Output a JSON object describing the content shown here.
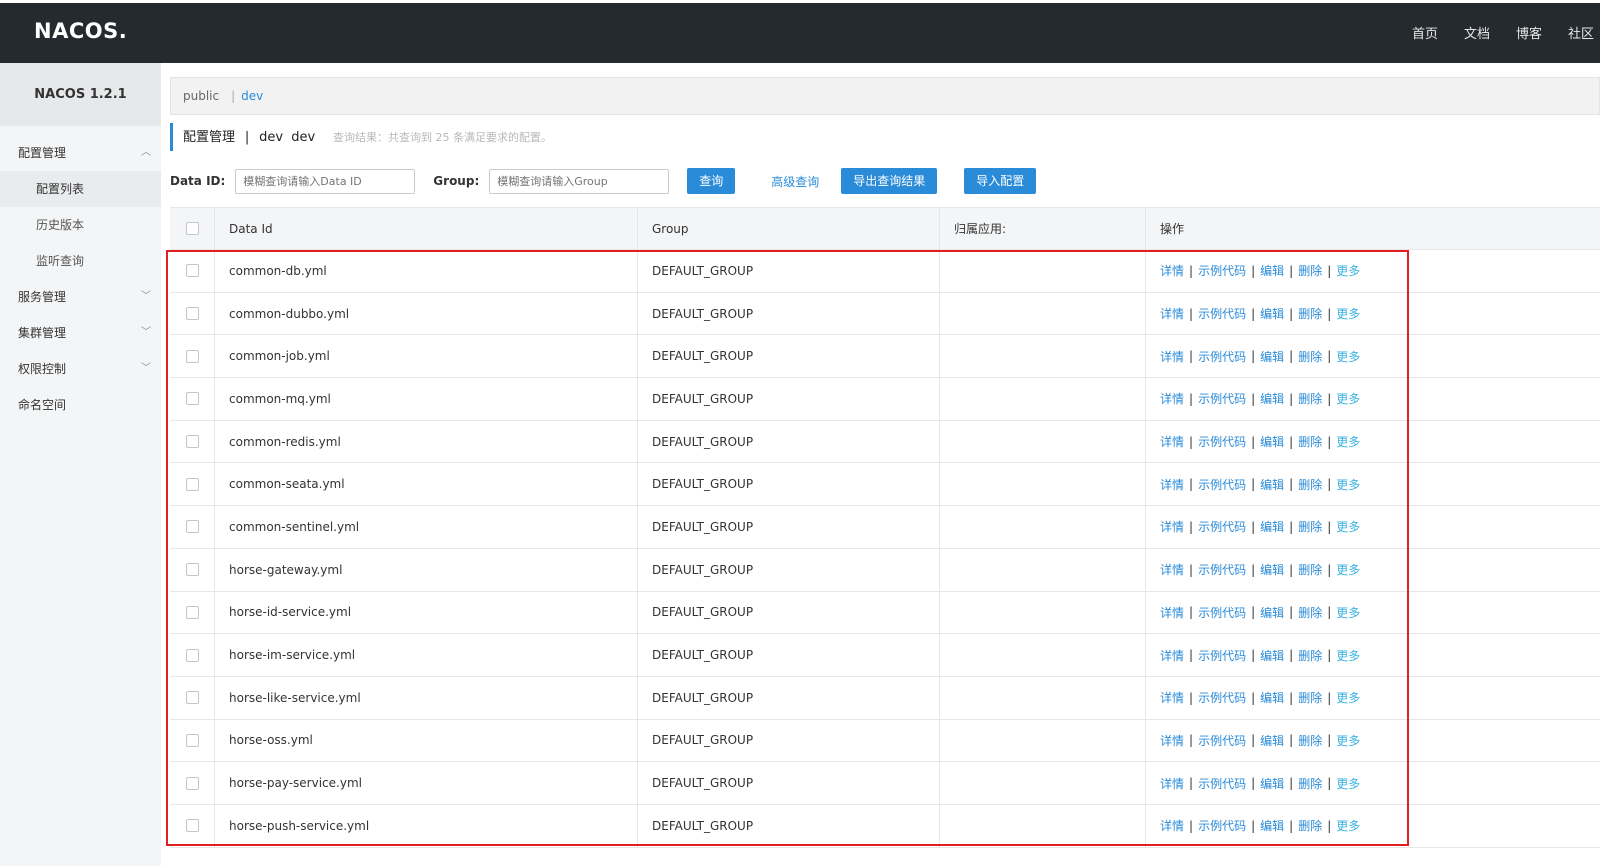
{
  "header": {
    "logo": "NACOS.",
    "nav": [
      "首页",
      "文档",
      "博客",
      "社区"
    ]
  },
  "sidebar": {
    "version": "NACOS 1.2.1",
    "menu": {
      "config": "配置管理",
      "config_list": "配置列表",
      "history": "历史版本",
      "listen": "监听查询",
      "service": "服务管理",
      "cluster": "集群管理",
      "auth": "权限控制",
      "namespace": "命名空间"
    }
  },
  "namespace_bar": {
    "public": "public",
    "separator": "|",
    "dev": "dev"
  },
  "title": {
    "main": "配置管理",
    "sep": "|",
    "ns": "dev  dev",
    "result": "查询结果：共查询到 25 条满足要求的配置。"
  },
  "filter": {
    "dataid_label": "Data ID:",
    "dataid_placeholder": "模糊查询请输入Data ID",
    "group_label": "Group:",
    "group_placeholder": "模糊查询请输入Group",
    "search_btn": "查询",
    "advanced": "高级查询",
    "export_btn": "导出查询结果",
    "import_btn": "导入配置"
  },
  "table": {
    "columns": [
      "Data Id",
      "Group",
      "归属应用:",
      "操作"
    ],
    "actions": [
      "详情",
      "示例代码",
      "编辑",
      "删除",
      "更多"
    ],
    "action_sep": "|",
    "rows": [
      {
        "data_id": "common-db.yml",
        "group": "DEFAULT_GROUP",
        "app": ""
      },
      {
        "data_id": "common-dubbo.yml",
        "group": "DEFAULT_GROUP",
        "app": ""
      },
      {
        "data_id": "common-job.yml",
        "group": "DEFAULT_GROUP",
        "app": ""
      },
      {
        "data_id": "common-mq.yml",
        "group": "DEFAULT_GROUP",
        "app": ""
      },
      {
        "data_id": "common-redis.yml",
        "group": "DEFAULT_GROUP",
        "app": ""
      },
      {
        "data_id": "common-seata.yml",
        "group": "DEFAULT_GROUP",
        "app": ""
      },
      {
        "data_id": "common-sentinel.yml",
        "group": "DEFAULT_GROUP",
        "app": ""
      },
      {
        "data_id": "horse-gateway.yml",
        "group": "DEFAULT_GROUP",
        "app": ""
      },
      {
        "data_id": "horse-id-service.yml",
        "group": "DEFAULT_GROUP",
        "app": ""
      },
      {
        "data_id": "horse-im-service.yml",
        "group": "DEFAULT_GROUP",
        "app": ""
      },
      {
        "data_id": "horse-like-service.yml",
        "group": "DEFAULT_GROUP",
        "app": ""
      },
      {
        "data_id": "horse-oss.yml",
        "group": "DEFAULT_GROUP",
        "app": ""
      },
      {
        "data_id": "horse-pay-service.yml",
        "group": "DEFAULT_GROUP",
        "app": ""
      },
      {
        "data_id": "horse-push-service.yml",
        "group": "DEFAULT_GROUP",
        "app": ""
      }
    ]
  },
  "colors": {
    "topbar": "#252a2f",
    "accent": "#2a8bd8",
    "highlight_box": "#e02020"
  }
}
